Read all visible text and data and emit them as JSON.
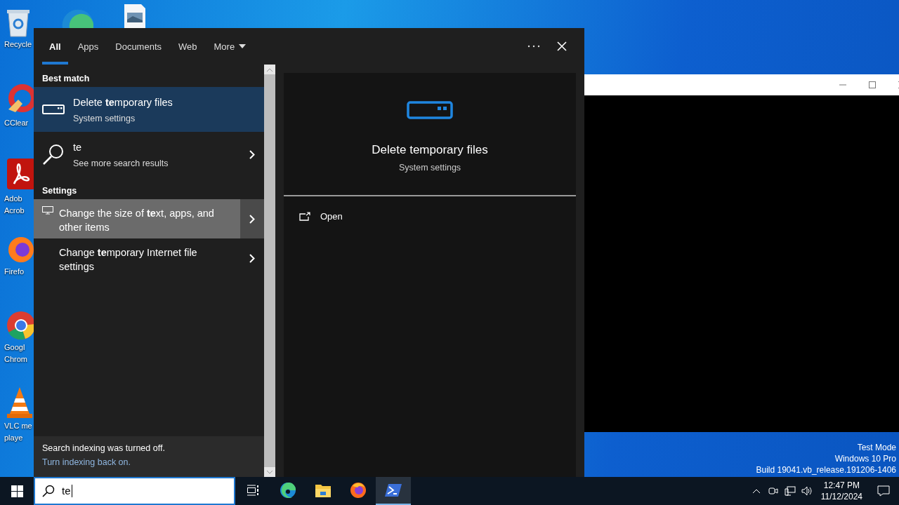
{
  "desktop_icons": [
    {
      "kind": "recycle",
      "lines": [
        "Recycle"
      ]
    },
    {
      "kind": "ccleaner",
      "lines": [
        "CClear"
      ]
    },
    {
      "kind": "acrobat",
      "lines": [
        "Adob",
        "Acrob"
      ]
    },
    {
      "kind": "firefox",
      "lines": [
        "Firefo"
      ]
    },
    {
      "kind": "chrome",
      "lines": [
        "Googl",
        "Chrom"
      ]
    },
    {
      "kind": "vlc",
      "lines": [
        "VLC me",
        "playe"
      ]
    }
  ],
  "search_panel": {
    "tabs": [
      {
        "label": "All",
        "selected": true
      },
      {
        "label": "Apps",
        "selected": false
      },
      {
        "label": "Documents",
        "selected": false
      },
      {
        "label": "Web",
        "selected": false
      },
      {
        "label": "More",
        "selected": false,
        "dropdown": true
      }
    ],
    "sections": [
      {
        "heading": "Best match",
        "items": [
          {
            "kind": "drive",
            "title": "Delete **te**mporary files",
            "subtitle": "System settings",
            "selected": true,
            "hovered": false,
            "arrow": false
          }
        ]
      },
      {
        "items": [
          {
            "kind": "search",
            "title": "te",
            "subtitle": "See more search results",
            "selected": false,
            "hovered": false,
            "arrow": true
          }
        ]
      },
      {
        "heading": "Settings",
        "items": [
          {
            "kind": "monitor",
            "title": "Change the size of **te**xt, apps, and other items",
            "selected": false,
            "hovered": true,
            "arrow": true
          },
          {
            "kind": "blank",
            "title": "Change **te**mporary Internet file settings",
            "selected": false,
            "hovered": false,
            "arrow": true
          }
        ]
      }
    ],
    "footer": {
      "message": "Search indexing was turned off.",
      "link": "Turn indexing back on."
    },
    "preview": {
      "title": "Delete temporary files",
      "subtitle": "System settings",
      "actions": [
        {
          "label": "Open"
        }
      ]
    }
  },
  "taskbar": {
    "search_value": "te",
    "apps": [
      {
        "kind": "taskview",
        "active": false
      },
      {
        "kind": "edge",
        "active": false
      },
      {
        "kind": "explorer",
        "active": false
      },
      {
        "kind": "firefox",
        "active": false
      },
      {
        "kind": "powershell",
        "active": true
      }
    ],
    "time": "12:47 PM",
    "date": "11/12/2024"
  },
  "watermark": [
    "Test Mode",
    "Windows 10 Pro",
    "Build 19041.vb_release.191206-1406"
  ]
}
